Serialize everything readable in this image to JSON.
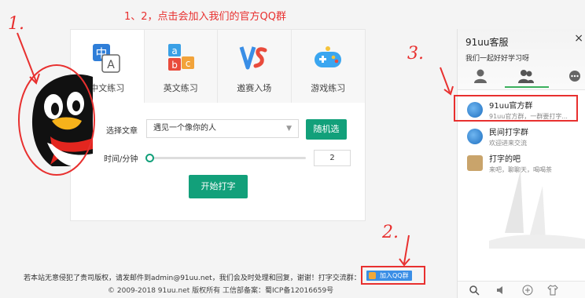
{
  "annotations": {
    "title_note": "1、2，点击会加入我们的官方QQ群",
    "num1": "1.",
    "num2": "2.",
    "num3": "3."
  },
  "tabs": [
    {
      "label": "中文练习",
      "icon": "chinese-char-icon",
      "active": true
    },
    {
      "label": "英文练习",
      "icon": "abc-blocks-icon",
      "active": false
    },
    {
      "label": "邀赛入场",
      "icon": "vs-icon",
      "active": false
    },
    {
      "label": "游戏练习",
      "icon": "gamepad-icon",
      "active": false
    }
  ],
  "form": {
    "article_label": "选择文章",
    "article_value": "遇见一个像你的人",
    "random_button": "随机选",
    "time_label": "时间/分钟",
    "time_value": "2",
    "slider_fraction": 0.02,
    "start_button": "开始打字"
  },
  "footer": {
    "notice": "若本站无意侵犯了贵司版权，请发邮件到admin@91uu.net，我们会及时处理和回复，谢谢！打字交流群：",
    "join_button": "加入QQ群",
    "copyright": "© 2009-2018 91uu.net 版权所有 工信部备案：蜀ICP备12016659号"
  },
  "panel": {
    "title": "91uu客服",
    "close": "×",
    "subtitle": "我们一起好好学习呀",
    "groups": [
      {
        "name": "91uu官方群",
        "desc": "91uu官方群，一群要打字..."
      },
      {
        "name": "民间打字群",
        "desc": "欢迎进来交流"
      },
      {
        "name": "打字的吧",
        "desc": "来吧，聊聊天，喝喝茶"
      }
    ]
  },
  "colors": {
    "accent": "#12a07a",
    "annotation_red": "#e8302f",
    "qq_blue": "#3a8ee6"
  }
}
